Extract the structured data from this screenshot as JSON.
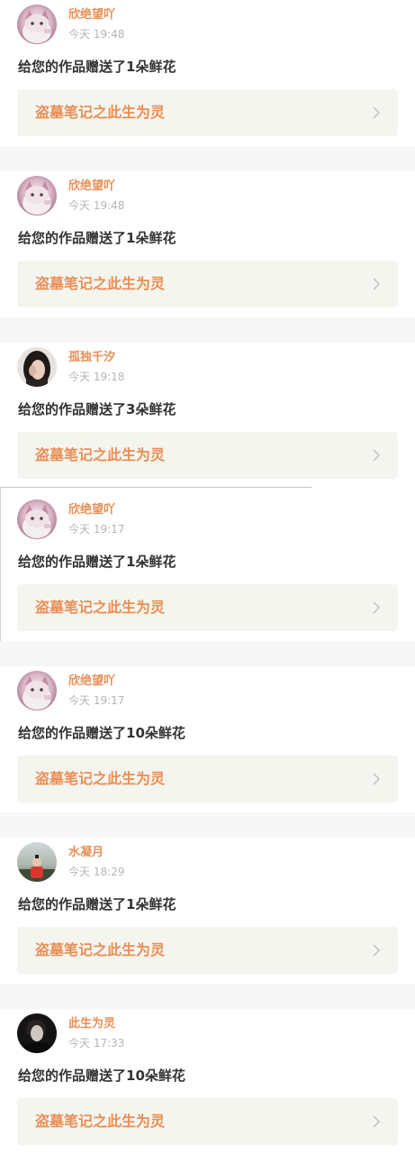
{
  "notifications": [
    {
      "avatar_icon": "cat-avatar-icon",
      "username": "欣绝望吖",
      "time": "今天 19:48",
      "message": "给您的作品赠送了1朵鲜花",
      "work_title": "盗墓笔记之此生为灵"
    },
    {
      "avatar_icon": "cat-avatar-icon",
      "username": "欣绝望吖",
      "time": "今天 19:48",
      "message": "给您的作品赠送了1朵鲜花",
      "work_title": "盗墓笔记之此生为灵"
    },
    {
      "avatar_icon": "girl-portrait-avatar-icon",
      "username": "孤独千汐",
      "time": "今天 19:18",
      "message": "给您的作品赠送了3朵鲜花",
      "work_title": "盗墓笔记之此生为灵"
    },
    {
      "avatar_icon": "cat-avatar-icon",
      "username": "欣绝望吖",
      "time": "今天 19:17",
      "message": "给您的作品赠送了1朵鲜花",
      "work_title": "盗墓笔记之此生为灵"
    },
    {
      "avatar_icon": "cat-avatar-icon",
      "username": "欣绝望吖",
      "time": "今天 19:17",
      "message": "给您的作品赠送了10朵鲜花",
      "work_title": "盗墓笔记之此生为灵"
    },
    {
      "avatar_icon": "outdoor-photo-avatar-icon",
      "username": "水凝月",
      "time": "今天 18:29",
      "message": "给您的作品赠送了1朵鲜花",
      "work_title": "盗墓笔记之此生为灵"
    },
    {
      "avatar_icon": "dark-portrait-avatar-icon",
      "username": "此生为灵",
      "time": "今天 17:33",
      "message": "给您的作品赠送了10朵鲜花",
      "work_title": "盗墓笔记之此生为灵"
    }
  ],
  "colors": {
    "accent": "#e88f57",
    "message_text": "#333333",
    "timestamp_text": "#b5b5b5",
    "link_background": "#f5f5ef",
    "separator": "#f7f7f7"
  },
  "icons": {
    "link_arrow": "chevron-right-icon"
  }
}
